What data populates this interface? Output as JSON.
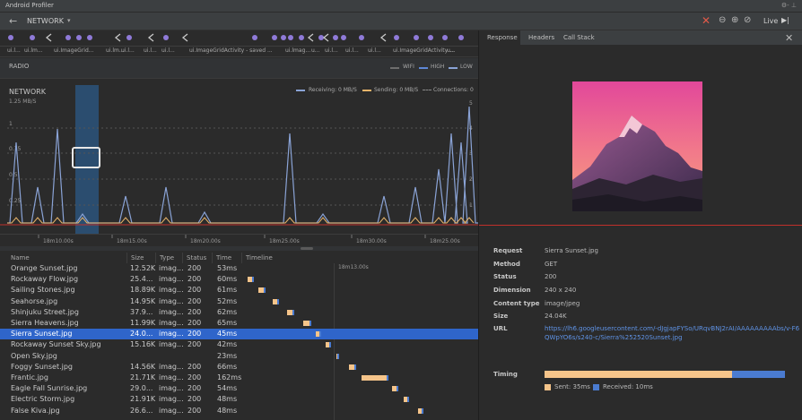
{
  "window": {
    "title": "Android Profiler",
    "controls": "⚙- ⊥"
  },
  "toolbar": {
    "section": "NETWORK",
    "live_label": "Live"
  },
  "events": {
    "activity_labels": [
      "ui.l...",
      "ui.lm...",
      "ui.ImageGrid...",
      "ui.lm...",
      "ui.l...",
      "ui.l...",
      "ui.l...",
      "ui.ImageGridActivity - saved ...",
      "ui.lmag...",
      "u...",
      "ui.l...",
      "ui.l...",
      "ui.l...",
      "ui.ImageGridActivity ...",
      "u..."
    ]
  },
  "radio": {
    "label": "RADIO",
    "legend": [
      "WIFI",
      "HIGH",
      "LOW"
    ]
  },
  "network": {
    "label": "NETWORK",
    "scale": "1.25 MB/S",
    "y_ticks": [
      "1",
      "0.75",
      "0.5",
      "0.25"
    ],
    "right_ticks": [
      "5",
      "4",
      "3",
      "2",
      "1"
    ],
    "legend": {
      "receiving": "Receiving: 0 MB/S",
      "sending": "Sending: 0 MB/S",
      "connections": "Connections: 0"
    },
    "colors": {
      "receiving": "#8aa3d6",
      "sending": "#e8b46a",
      "connections": "#8a8a8a",
      "selection": "#2b6aa8",
      "red_line": "#c0302b"
    },
    "time_ticks": [
      "18m10.00s",
      "18m15.00s",
      "18m20.00s",
      "18m25.00s",
      "18m30.00s",
      "18m25.00s"
    ]
  },
  "table": {
    "headers": [
      "Name",
      "Size",
      "Type",
      "Status",
      "Time",
      "Timeline"
    ],
    "timeline_marker": "18m13.00s",
    "rows": [
      {
        "name": "Orange Sunset.jpg",
        "size": "12.52K",
        "type": "imag...",
        "status": "200",
        "time": "53ms"
      },
      {
        "name": "Rockaway Flow.jpg",
        "size": "25.4...",
        "type": "imag...",
        "status": "200",
        "time": "60ms"
      },
      {
        "name": "Sailing Stones.jpg",
        "size": "18.89K",
        "type": "imag...",
        "status": "200",
        "time": "61ms"
      },
      {
        "name": "Seahorse.jpg",
        "size": "14.95K",
        "type": "imag...",
        "status": "200",
        "time": "52ms"
      },
      {
        "name": "Shinjuku Street.jpg",
        "size": "37.9...",
        "type": "imag...",
        "status": "200",
        "time": "62ms"
      },
      {
        "name": "Sierra Heavens.jpg",
        "size": "11.99K",
        "type": "imag...",
        "status": "200",
        "time": "65ms"
      },
      {
        "name": "Sierra Sunset.jpg",
        "size": "24.0...",
        "type": "imag...",
        "status": "200",
        "time": "45ms",
        "selected": true
      },
      {
        "name": "Rockaway Sunset Sky.jpg",
        "size": "15.16K",
        "type": "imag...",
        "status": "200",
        "time": "42ms"
      },
      {
        "name": "Open Sky.jpg",
        "size": "",
        "type": "",
        "status": "",
        "time": "23ms"
      },
      {
        "name": "Foggy Sunset.jpg",
        "size": "14.56K",
        "type": "imag...",
        "status": "200",
        "time": "66ms"
      },
      {
        "name": "Frantic.jpg",
        "size": "21.71K",
        "type": "imag...",
        "status": "200",
        "time": "162ms"
      },
      {
        "name": "Eagle Fall Sunrise.jpg",
        "size": "29.0...",
        "type": "imag...",
        "status": "200",
        "time": "54ms"
      },
      {
        "name": "Electric Storm.jpg",
        "size": "21.91K",
        "type": "imag...",
        "status": "200",
        "time": "48ms"
      },
      {
        "name": "False Kiva.jpg",
        "size": "26.6...",
        "type": "imag...",
        "status": "200",
        "time": "48ms"
      }
    ]
  },
  "details": {
    "tabs": [
      "Response",
      "Headers",
      "Call Stack"
    ],
    "fields": [
      {
        "label": "Request",
        "value": "Sierra Sunset.jpg"
      },
      {
        "label": "Method",
        "value": "GET"
      },
      {
        "label": "Status",
        "value": "200"
      },
      {
        "label": "Dimension",
        "value": "240 x 240"
      },
      {
        "label": "Content type",
        "value": "image/jpeg"
      },
      {
        "label": "Size",
        "value": "24.04K"
      },
      {
        "label": "URL",
        "value": "https://lh6.googleusercontent.com/-dJgjapFYSo/URqvBNJ2rAI/AAAAAAAAAbs/v-F6",
        "value2": "QWpYO6s/s240-c/Sierra%252520Sunset.jpg"
      }
    ],
    "timing": {
      "label": "Timing",
      "sent": "Sent: 35ms",
      "received": "Received: 10ms",
      "sent_fraction": 0.78,
      "colors": {
        "sent": "#f5c48a",
        "received": "#4a7bd0"
      }
    }
  }
}
